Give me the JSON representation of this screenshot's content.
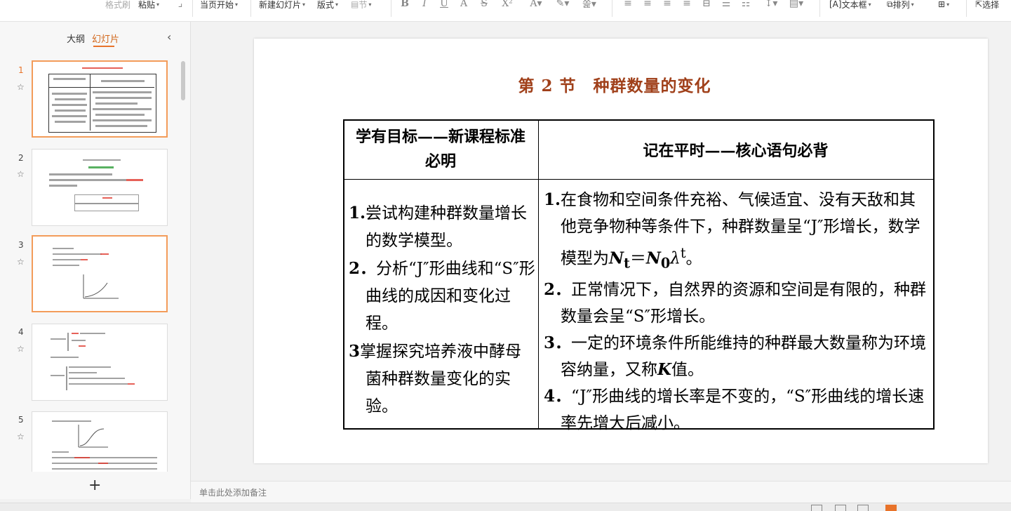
{
  "toolbar": {
    "format_painter": "格式刷",
    "paste": "粘贴",
    "current_start": "当页开始",
    "new_slide": "新建幻灯片",
    "layout": "版式",
    "section": "节",
    "text_box": "文本框",
    "arrange": "排列",
    "select": "选择"
  },
  "left_pane": {
    "tab_outline": "大纲",
    "tab_slides": "幻灯片",
    "slides": [
      {
        "number": "1"
      },
      {
        "number": "2"
      },
      {
        "number": "3"
      },
      {
        "number": "4"
      },
      {
        "number": "5"
      }
    ]
  },
  "slide": {
    "title": "第 2 节　种群数量的变化",
    "table": {
      "header_left": "学有目标——新课程标准必明",
      "header_right": "记在平时——核心语句必背",
      "left_items": [
        {
          "num": "1.",
          "text": "尝试构建种群数量增长的数学模型。"
        },
        {
          "num": "2．",
          "text": "分析“J″形曲线和“S″形曲线的成因和变化过程。"
        },
        {
          "num": "3",
          "text": "掌握探究培养液中酵母菌种群数量变化的实验。"
        }
      ],
      "right_items": [
        {
          "num": "1.",
          "text_a": "在食物和空间条件充裕、气候适宜、没有天敌和其他竞争物种等条件下，种群数量呈“J″形增长，数学模型为",
          "formula_lhs": "N",
          "formula_lhs_sub": "t",
          "formula_eq": "＝",
          "formula_rhs": "N",
          "formula_rhs_sub": "0",
          "formula_lambda": "λ",
          "formula_exp": "t",
          "text_b": "。"
        },
        {
          "num": "2．",
          "text": "正常情况下，自然界的资源和空间是有限的，种群数量会呈“S″形增长。"
        },
        {
          "num": "3．",
          "text_a": "一定的环境条件所能维持的种群最大数量称为环境容纳量，又称",
          "k": "K",
          "text_b": "值。"
        },
        {
          "num": "4．",
          "text": "“J″形曲线的增长率是不变的，“S″形曲线的增长速率先增大后减小。"
        }
      ]
    }
  },
  "notes": {
    "placeholder": "单击此处添加备注"
  }
}
